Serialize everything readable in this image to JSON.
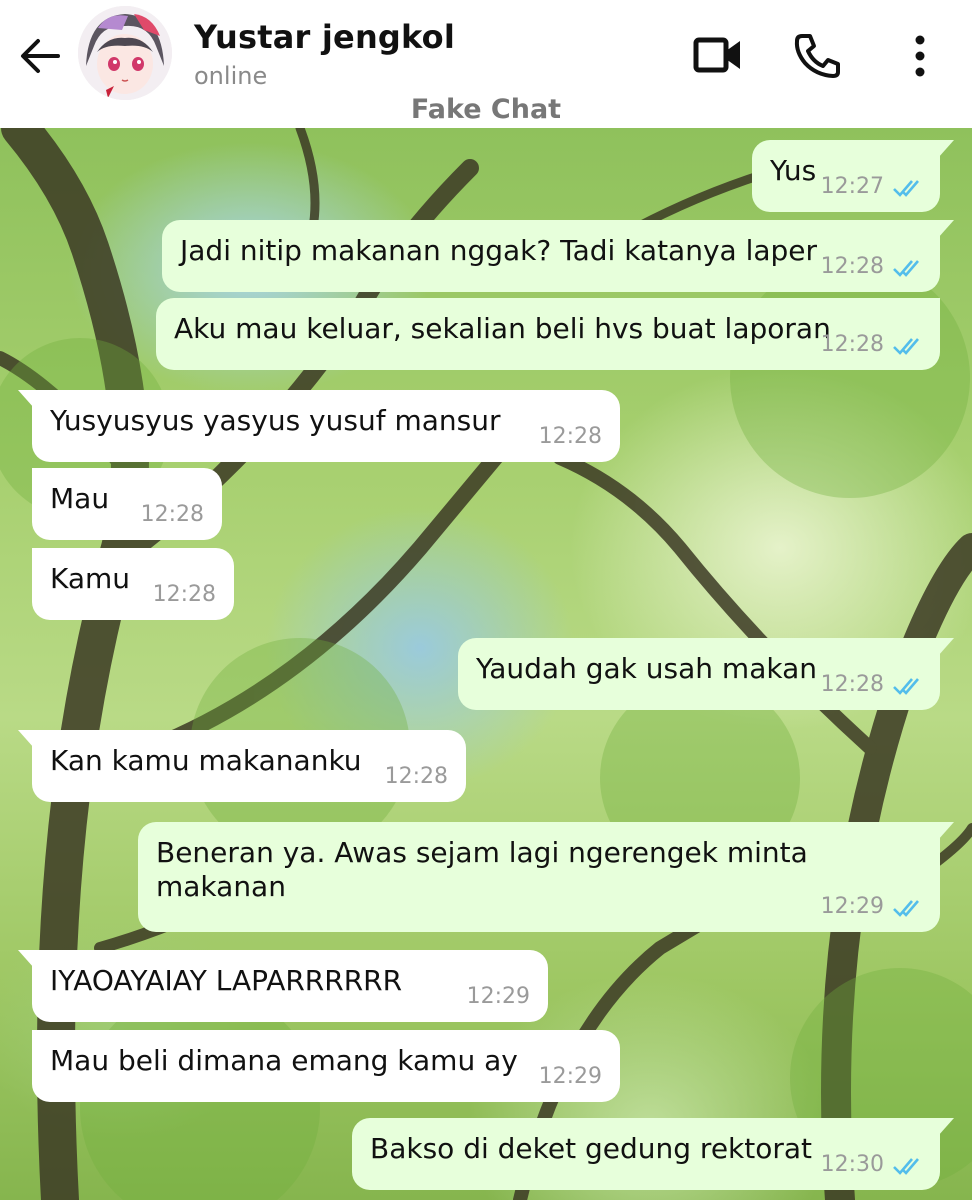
{
  "contact": {
    "name": "Yustar jengkol",
    "status": "online"
  },
  "watermark": "Fake Chat",
  "icons": {
    "back": "arrow-left-icon",
    "video": "video-camera-icon",
    "call": "phone-icon",
    "more": "more-vertical-icon",
    "read": "double-check-icon"
  },
  "colors": {
    "incoming_bubble": "#ffffff",
    "outgoing_bubble": "#e7ffdb",
    "read_tick": "#53bdeb"
  },
  "messages": [
    {
      "dir": "out",
      "text": "Yus",
      "time": "12:27"
    },
    {
      "dir": "out",
      "text": "Jadi nitip makanan nggak? Tadi katanya laper",
      "time": "12:28"
    },
    {
      "dir": "out",
      "text": "Aku mau keluar, sekalian beli hvs buat laporan",
      "time": "12:28"
    },
    {
      "dir": "in",
      "text": "Yusyusyus yasyus yusuf mansur",
      "time": "12:28"
    },
    {
      "dir": "in",
      "text": "Mau",
      "time": "12:28"
    },
    {
      "dir": "in",
      "text": "Kamu",
      "time": "12:28"
    },
    {
      "dir": "out",
      "text": "Yaudah gak usah makan",
      "time": "12:28"
    },
    {
      "dir": "in",
      "text": "Kan kamu makananku",
      "time": "12:28"
    },
    {
      "dir": "out",
      "text": "Beneran ya. Awas sejam lagi ngerengek minta makanan",
      "time": "12:29"
    },
    {
      "dir": "in",
      "text": "IYAOAYAIAY LAPARRRRRR",
      "time": "12:29"
    },
    {
      "dir": "in",
      "text": "Mau beli dimana emang kamu ay",
      "time": "12:29"
    },
    {
      "dir": "out",
      "text": "Bakso di deket gedung rektorat",
      "time": "12:30"
    }
  ]
}
